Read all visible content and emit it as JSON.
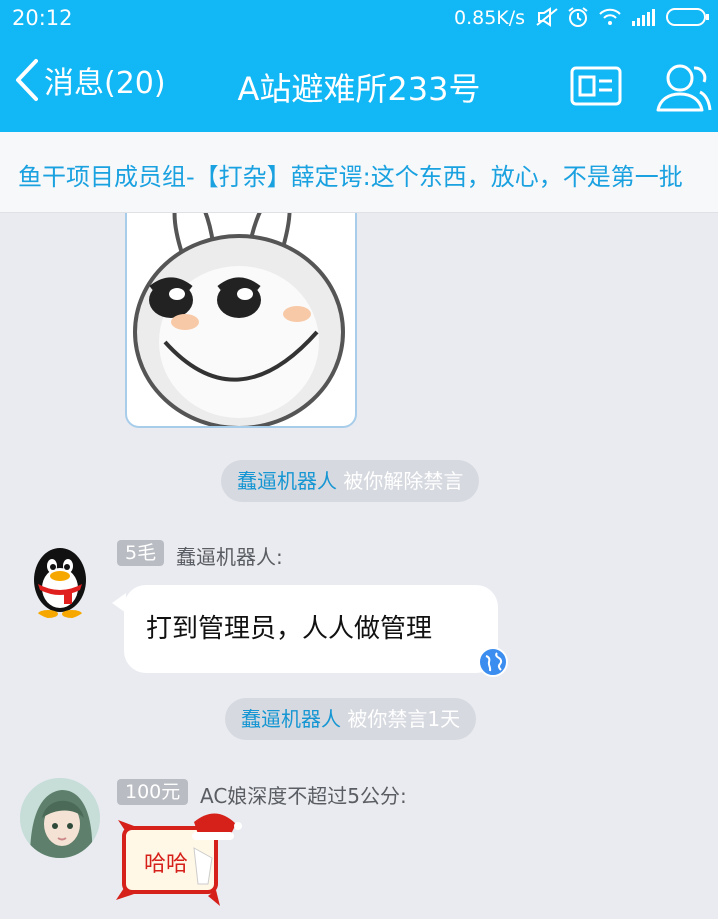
{
  "status_bar": {
    "time": "20:12",
    "network_speed": "0.85K/s",
    "icons": [
      "mute-icon",
      "alarm-icon",
      "wifi-icon",
      "signal-icon",
      "battery-icon"
    ]
  },
  "header": {
    "back_label": "消息(20)",
    "title": "A站避难所233号",
    "card_icon": "profile-card-icon",
    "members_icon": "group-members-icon"
  },
  "notice": {
    "text": "鱼干项目成员组-【打杂】薛定谔:这个东西，放心，不是第一批"
  },
  "messages": [
    {
      "type": "system",
      "actor": "蠢逼机器人",
      "text": " 被你解除禁言"
    },
    {
      "type": "text",
      "badge": "5毛",
      "sender": "蠢逼机器人:",
      "text": "打到管理员，人人做管理",
      "avatar": "qq-penguin-avatar"
    },
    {
      "type": "system",
      "actor": "蠢逼机器人",
      "text": " 被你禁言1天"
    },
    {
      "type": "sticker",
      "badge": "100元",
      "sender": "AC娘深度不超过5公分:",
      "sticker_text": "哈哈",
      "avatar": "anime-girl-avatar"
    }
  ],
  "colors": {
    "brand": "#12b7f5",
    "link": "#1696d3",
    "background": "#e9ebf0"
  }
}
